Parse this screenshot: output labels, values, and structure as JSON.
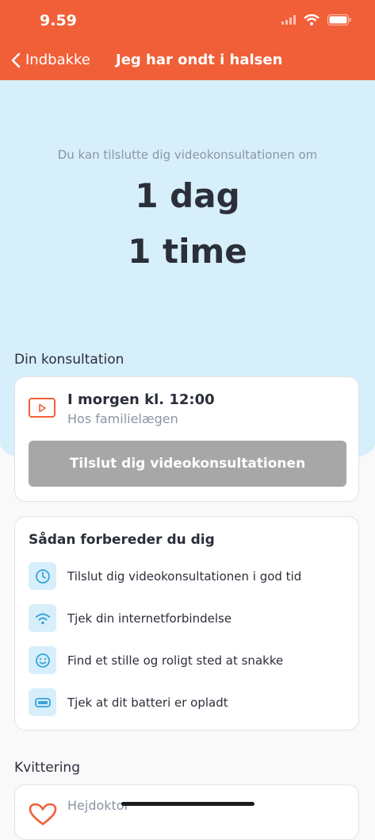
{
  "status_bar": {
    "time": "9.59"
  },
  "nav": {
    "back_label": "Indbakke",
    "title": "Jeg har ondt i halsen"
  },
  "countdown": {
    "label": "Du kan tilslutte dig videokonsultationen om",
    "days": "1 dag",
    "hours": "1 time"
  },
  "consultation": {
    "section_title": "Din konsultation",
    "time": "I morgen kl. 12:00",
    "place": "Hos familielægen",
    "join_label": "Tilslut dig videokonsultationen"
  },
  "prep": {
    "title": "Sådan forbereder du dig",
    "items": [
      {
        "icon": "clock-icon",
        "text": "Tilslut dig videokonsultationen i god tid"
      },
      {
        "icon": "wifi-icon",
        "text": "Tjek din internetforbindelse"
      },
      {
        "icon": "smiley-icon",
        "text": "Find et stille og roligt sted at snakke"
      },
      {
        "icon": "battery-icon",
        "text": "Tjek at dit batteri er opladt"
      }
    ]
  },
  "receipt": {
    "section_title": "Kvittering",
    "name": "Hejdoktor"
  },
  "colors": {
    "brand": "#f15f38",
    "hero_bg": "#d7effb",
    "icon_blue": "#3aa3dc",
    "disabled": "#a7a7a7"
  }
}
